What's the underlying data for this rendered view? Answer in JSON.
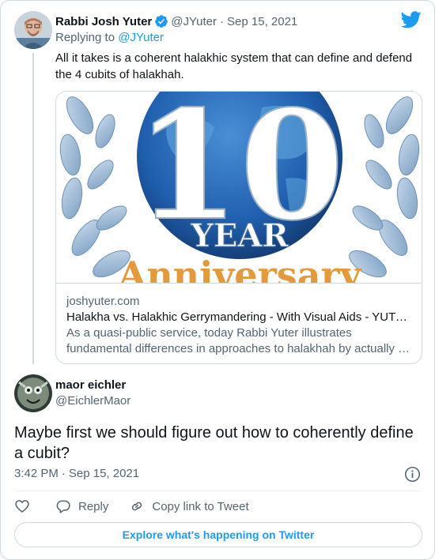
{
  "parent_tweet": {
    "author_name": "Rabbi Josh Yuter",
    "handle": "@JYuter",
    "separator": "·",
    "date": "Sep 15, 2021",
    "replying_prefix": "Replying to",
    "replying_to": "@JYuter",
    "text": "All it takes is a coherent halakhic system that can define and defend the 4 cubits of halakhah.",
    "card": {
      "image_number": "10",
      "image_word": "YEAR",
      "image_partial_word": "Anniversary",
      "domain": "joshyuter.com",
      "title": "Halakha vs. Halakhic Gerrymandering - With Visual Aids - YUTOPIA",
      "description_line1": "As a quasi-public service, today Rabbi Yuter illustrates",
      "description_line2": "fundamental differences in approaches to halakhah by actually drawing them"
    }
  },
  "main_tweet": {
    "author_name": "maor eichler",
    "handle": "@EichlerMaor",
    "text": "Maybe first we should figure out how to coherently define a cubit?",
    "time": "3:42 PM",
    "separator": "·",
    "date": "Sep 15, 2021"
  },
  "actions": {
    "reply_label": "Reply",
    "copy_link_label": "Copy link to Tweet"
  },
  "explore_label": "Explore what's happening on Twitter",
  "icons": {
    "brand": "twitter-bird-icon",
    "verified": "verified-badge-icon",
    "info": "info-icon",
    "like": "heart-icon",
    "reply": "reply-bubble-icon",
    "copy_link": "link-icon"
  },
  "colors": {
    "accent": "#1d9bf0",
    "text": "#0f1419",
    "muted": "#536471",
    "border": "#cfd9de"
  }
}
